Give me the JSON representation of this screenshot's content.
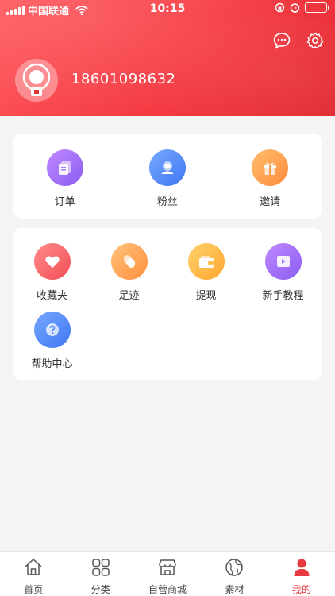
{
  "status_bar": {
    "carrier": "中国联通",
    "time": "10:15"
  },
  "profile": {
    "phone": "18601098632"
  },
  "colors": {
    "brand": "#f4373f",
    "tab_active": "#e83a40"
  },
  "top_actions": [
    {
      "icon": "message-icon"
    },
    {
      "icon": "gear-icon"
    }
  ],
  "primary_menu": [
    {
      "label": "订单",
      "icon": "order-icon"
    },
    {
      "label": "粉丝",
      "icon": "fans-icon"
    },
    {
      "label": "邀请",
      "icon": "gift-icon"
    }
  ],
  "secondary_menu": [
    {
      "label": "收藏夹",
      "icon": "heart-icon"
    },
    {
      "label": "足迹",
      "icon": "footprint-icon"
    },
    {
      "label": "提现",
      "icon": "wallet-icon"
    },
    {
      "label": "新手教程",
      "icon": "video-icon"
    },
    {
      "label": "帮助中心",
      "icon": "help-icon"
    }
  ],
  "tabbar": [
    {
      "label": "首页",
      "icon": "home-icon"
    },
    {
      "label": "分类",
      "icon": "category-icon"
    },
    {
      "label": "自营商城",
      "icon": "store-icon"
    },
    {
      "label": "素材",
      "icon": "globe-icon"
    },
    {
      "label": "我的",
      "icon": "user-icon",
      "active": true
    }
  ]
}
